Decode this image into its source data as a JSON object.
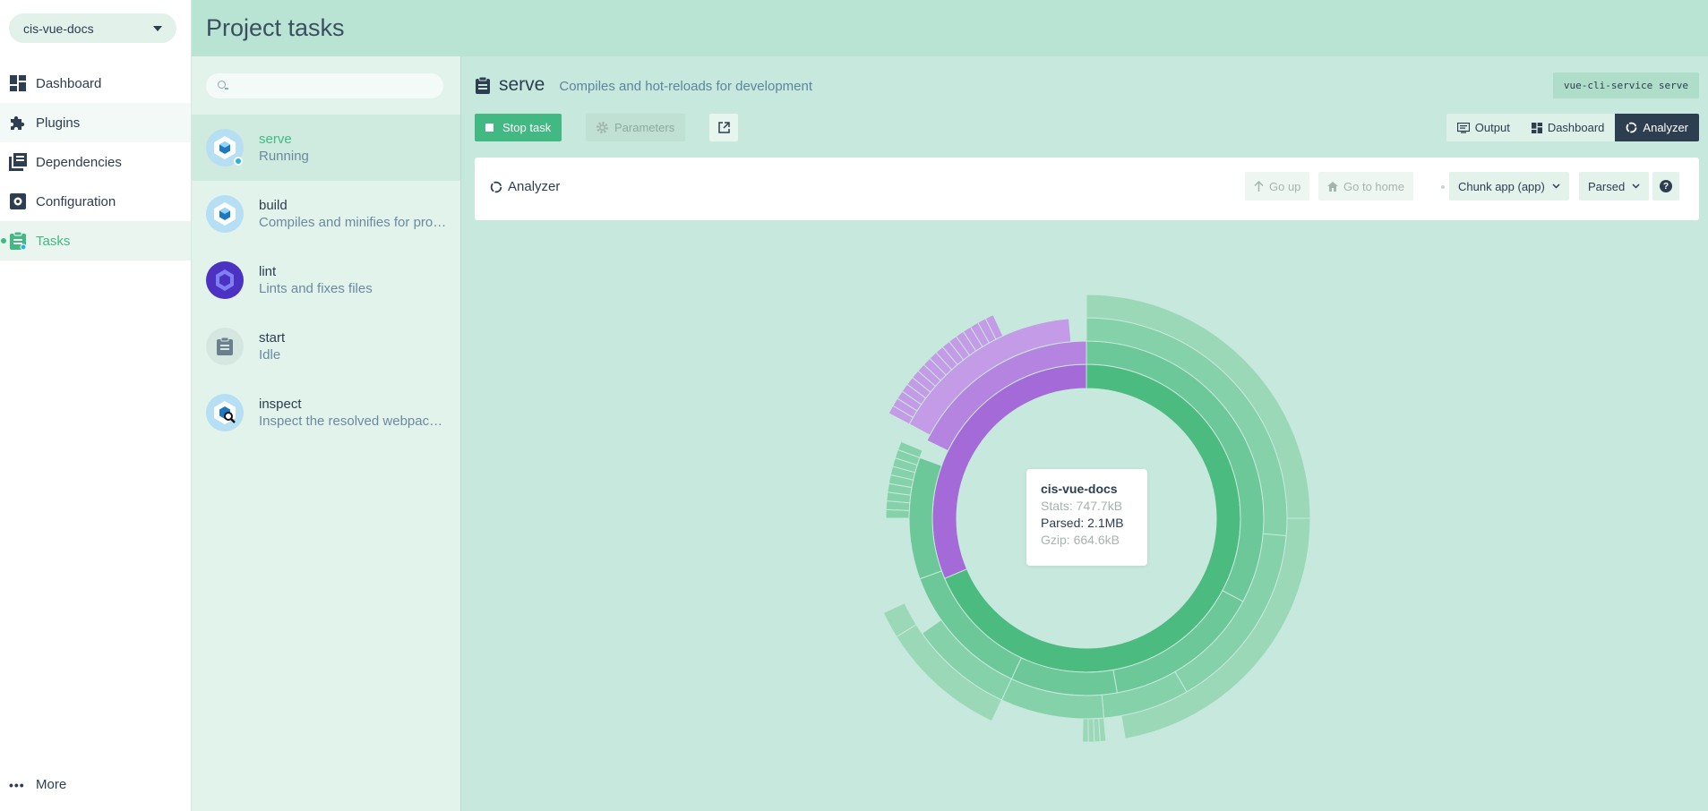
{
  "project": {
    "name": "cis-vue-docs"
  },
  "nav": {
    "items": [
      {
        "label": "Dashboard",
        "icon": "dashboard-icon"
      },
      {
        "label": "Plugins",
        "icon": "puzzle-icon"
      },
      {
        "label": "Dependencies",
        "icon": "library-icon"
      },
      {
        "label": "Configuration",
        "icon": "settings-icon"
      },
      {
        "label": "Tasks",
        "icon": "clipboard-icon"
      }
    ],
    "more_label": "More"
  },
  "header": {
    "title": "Project tasks"
  },
  "tasks": [
    {
      "name": "serve",
      "desc": "Running",
      "icon": "webpack-icon"
    },
    {
      "name": "build",
      "desc": "Compiles and minifies for production",
      "icon": "webpack-icon"
    },
    {
      "name": "lint",
      "desc": "Lints and fixes files",
      "icon": "eslint-icon"
    },
    {
      "name": "start",
      "desc": "Idle",
      "icon": "clipboard-icon"
    },
    {
      "name": "inspect",
      "desc": "Inspect the resolved webpack config",
      "icon": "webpack-inspect-icon"
    }
  ],
  "task_detail": {
    "name": "serve",
    "description": "Compiles and hot-reloads for development",
    "command": "vue-cli-service serve",
    "stop_label": "Stop task",
    "params_label": "Parameters",
    "views": [
      "Output",
      "Dashboard",
      "Analyzer"
    ],
    "active_view": "Analyzer"
  },
  "analyzer": {
    "label": "Analyzer",
    "go_up": "Go up",
    "go_home": "Go to home",
    "chunk_select": "Chunk app (app)",
    "size_select": "Parsed",
    "help": "?"
  },
  "tooltip": {
    "name": "cis-vue-docs",
    "stats": "Stats: 747.7kB",
    "parsed": "Parsed: 2.1MB",
    "gzip": "Gzip: 664.6kB"
  },
  "colors": {
    "accent": "#42b983",
    "dark": "#2c3e50",
    "purple": "#a46bd8",
    "running": "#26b3e0"
  }
}
